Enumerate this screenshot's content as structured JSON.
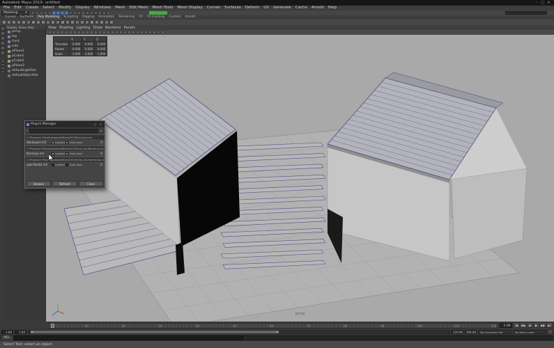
{
  "titlebar": {
    "title": "Autodesk Maya 2019: untitled",
    "minimize": "–",
    "maximize": "▢",
    "close": "✕"
  },
  "menubar": {
    "items": [
      "File",
      "Edit",
      "Create",
      "Select",
      "Modify",
      "Display",
      "Windows",
      "Mesh",
      "Edit Mesh",
      "Mesh Tools",
      "Mesh Display",
      "Curves",
      "Surfaces",
      "Deform",
      "UV",
      "Generate",
      "Cache",
      "Arnold",
      "Help"
    ]
  },
  "statusline": {
    "menuset_label": "Modeling",
    "menuset_caret": "▾",
    "icons": [
      "new-scene",
      "open-scene",
      "save-scene",
      "undo",
      "redo",
      "snap-to-grid",
      "snap-to-curve",
      "snap-to-point",
      "snap-to-view-plane",
      "make-live",
      "highlight-selection",
      "select-by-hierarchy",
      "select-by-object",
      "select-by-component",
      "symmetry",
      "render-current-frame",
      "ipr-render",
      "render-settings",
      "display-render-globals"
    ],
    "active_indices": [
      5,
      6,
      7,
      8
    ],
    "badge_color": "#3fae3f",
    "field_placeholder": ""
  },
  "shelf": {
    "tabs": [
      "Curves",
      "Surfaces",
      "Poly Modeling",
      "Sculpting",
      "Rigging",
      "Animation",
      "Rendering",
      "FX",
      "FX Caching",
      "Custom",
      "Arnold"
    ],
    "active_tab": "Poly Modeling",
    "icons": [
      "poly-sphere",
      "poly-cube",
      "poly-cylinder",
      "poly-cone",
      "poly-torus",
      "poly-plane",
      "poly-disc",
      "platonic-solid",
      "poly-pyramid",
      "poly-pipe",
      "poly-helix",
      "poly-gear",
      "soccer-ball",
      "super-ellipse",
      "spherical-harmonics",
      "ultra-shape",
      "multi-cut",
      "target-weld",
      "bevel",
      "bridge",
      "extrude",
      "quad-draw",
      "mirror"
    ]
  },
  "toolbox": {
    "tools": [
      "select-tool",
      "lasso-select-tool",
      "paint-select-tool",
      "move-tool",
      "rotate-tool",
      "scale-tool"
    ],
    "layouts": [
      "single-pane-layout",
      "four-pane-layout",
      "persp-outliner-layout",
      "hypershade-layout"
    ]
  },
  "outliner": {
    "menus": [
      "Display",
      "Show",
      "Help"
    ],
    "items": [
      {
        "name": "persp",
        "type": "camera"
      },
      {
        "name": "top",
        "type": "camera"
      },
      {
        "name": "front",
        "type": "camera"
      },
      {
        "name": "side",
        "type": "camera"
      },
      {
        "name": "pPlane1",
        "type": "mesh"
      },
      {
        "name": "pCube1",
        "type": "mesh"
      },
      {
        "name": "pCube2",
        "type": "mesh"
      },
      {
        "name": "pPlane2",
        "type": "mesh"
      },
      {
        "name": "defaultLightSet",
        "type": "set"
      },
      {
        "name": "defaultObjectSet",
        "type": "set"
      }
    ]
  },
  "viewport": {
    "menus": [
      "View",
      "Shading",
      "Lighting",
      "Show",
      "Renderer",
      "Panels"
    ],
    "camera_label": "persp",
    "toolbar_icons": [
      "select-camera",
      "lock-camera",
      "camera-attributes",
      "bookmarks",
      "image-plane",
      "2d-pan-zoom",
      "overscan",
      "grid-display",
      "film-gate",
      "resolution-gate",
      "gate-mask",
      "field-chart",
      "safe-action",
      "safe-title",
      "wireframe-mode",
      "shaded-mode",
      "textured-mode",
      "use-default-material",
      "wireframe-on-shaded",
      "lighting-all",
      "shadows",
      "screen-space-ao",
      "motion-blur",
      "anti-aliasing",
      "exposure",
      "gamma",
      "isolate-select",
      "xray"
    ],
    "hud_table": {
      "header": [
        "",
        "X",
        "Y",
        "Z"
      ],
      "rows": [
        [
          "Translate",
          "0.000",
          "0.000",
          "0.000"
        ],
        [
          "Rotate",
          "0.000",
          "0.000",
          "0.000"
        ],
        [
          "Scale",
          "1.000",
          "1.000",
          "1.000"
        ]
      ]
    }
  },
  "plugin_manager": {
    "title": "Plug-in Manager",
    "minimize": "–",
    "maximize": "▢",
    "close": "✕",
    "search_icon": "🔍",
    "search_placeholder": "",
    "loaded_label": "Loaded",
    "autoload_label": "Auto load",
    "info_icon": "i",
    "sections": [
      {
        "path": "C:/Program Files/Autodesk/Maya2019/bin/plug-ins",
        "plugins": [
          {
            "name": "AbcExport.mll",
            "loaded": true,
            "autoload": true
          }
        ]
      },
      {
        "path": "C:/Program Files/Autodesk/Maya2019/plug-ins/fbx/plug-ins",
        "plugins": [
          {
            "name": "fbxmaya.mll",
            "loaded": true,
            "autoload": true
          }
        ]
      },
      {
        "path": "C:/Program Files/Autodesk/Maya2019/plug-ins/xgen/plug-ins",
        "plugins": [
          {
            "name": "xgenToolkit.mll",
            "loaded": false,
            "autoload": false
          }
        ]
      }
    ],
    "buttons": [
      "Browse",
      "Refresh",
      "Close"
    ]
  },
  "timeline": {
    "tick_labels": [
      "10",
      "20",
      "30",
      "40",
      "50",
      "60",
      "70",
      "80",
      "90",
      "100",
      "110",
      "120"
    ],
    "current_frame": "1.00",
    "playback": [
      "|◀",
      "◀◀",
      "◀",
      "▶",
      "▶▶",
      "▶|"
    ]
  },
  "range_slider": {
    "anim_start": "1.00",
    "playback_start": "1.00",
    "playback_end": "120.00",
    "anim_end": "200.00",
    "character_set_label": "No Character Set",
    "anim_layer_label": "No Anim Layer"
  },
  "command_line": {
    "label": "MEL",
    "placeholder": ""
  },
  "help_line": {
    "text": "Select Tool: select an object"
  }
}
